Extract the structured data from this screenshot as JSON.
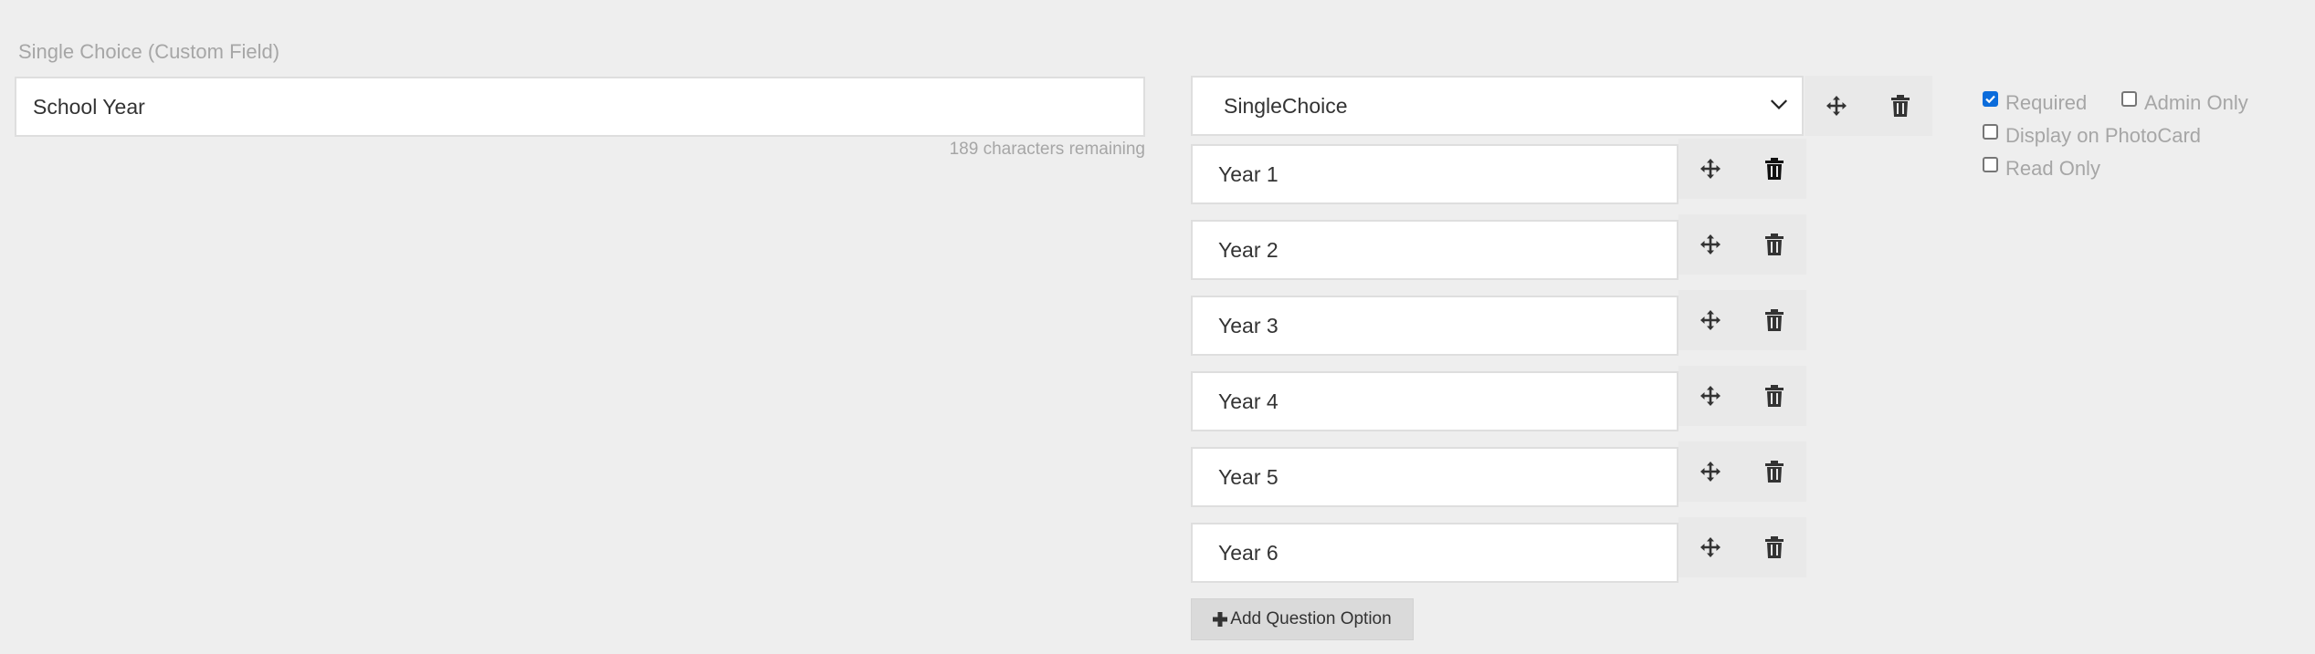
{
  "field": {
    "label": "Single Choice (Custom Field)",
    "name_value": "School Year",
    "chars_remaining": "189 characters remaining"
  },
  "type_select": {
    "value": "SingleChoice"
  },
  "options": [
    {
      "value": "Year 1"
    },
    {
      "value": "Year 2"
    },
    {
      "value": "Year 3"
    },
    {
      "value": "Year 4"
    },
    {
      "value": "Year 5"
    },
    {
      "value": "Year 6"
    }
  ],
  "add_option_label": "Add Question Option",
  "settings": {
    "required": {
      "label": "Required",
      "checked": true
    },
    "admin_only": {
      "label": "Admin Only",
      "checked": false
    },
    "display_on_photocard": {
      "label": "Display on PhotoCard",
      "checked": false
    },
    "read_only": {
      "label": "Read Only",
      "checked": false
    }
  },
  "colors": {
    "background": "#eeeeee",
    "checkbox_accent": "#0b6cdb",
    "muted_text": "#a6a6a6"
  },
  "icons": {
    "move": "move-arrows-icon",
    "delete": "trash-icon",
    "add": "plus-icon",
    "dropdown": "chevron-down-icon"
  }
}
